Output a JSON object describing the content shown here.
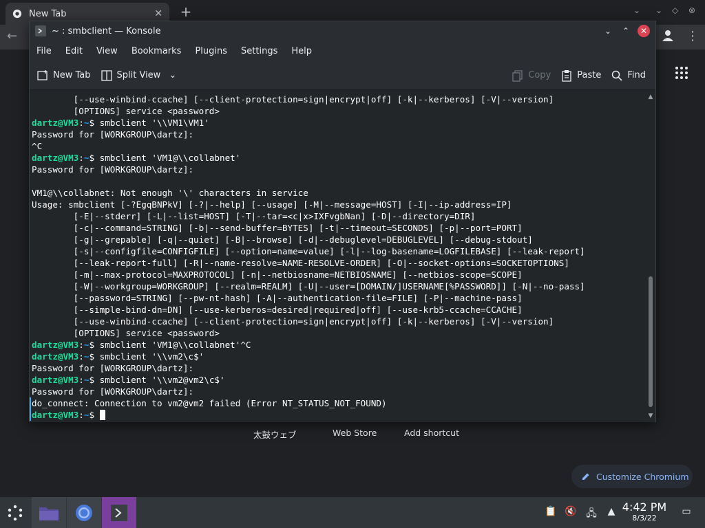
{
  "browser": {
    "tab_title": "New Tab",
    "tab_close": "✕",
    "new_tab": "+",
    "shortcuts": [
      "太鼓ウェブ",
      "Web Store",
      "Add shortcut"
    ],
    "customize_label": "Customize Chromium",
    "window_controls": [
      "⌄",
      "⌄",
      "◇",
      "⊗"
    ]
  },
  "konsole": {
    "title": "~ : smbclient — Konsole",
    "menu": [
      "File",
      "Edit",
      "View",
      "Bookmarks",
      "Plugins",
      "Settings",
      "Help"
    ],
    "toolbar": {
      "new_tab": "New Tab",
      "split_view": "Split View",
      "copy": "Copy",
      "paste": "Paste",
      "find": "Find"
    },
    "terminal": {
      "prompt_user": "dartz@VM3",
      "prompt_sep": ":",
      "prompt_path": "~",
      "prompt_end": "$ ",
      "lines": [
        {
          "type": "out",
          "text": "        [--use-winbind-ccache] [--client-protection=sign|encrypt|off] [-k|--kerberos] [-V|--version]"
        },
        {
          "type": "out",
          "text": "        [OPTIONS] service <password>"
        },
        {
          "type": "cmd",
          "text": "smbclient '\\\\VM1\\VM1'"
        },
        {
          "type": "out",
          "text": "Password for [WORKGROUP\\dartz]:"
        },
        {
          "type": "out",
          "text": "^C"
        },
        {
          "type": "cmd",
          "text": "smbclient 'VM1@\\\\collabnet'"
        },
        {
          "type": "out",
          "text": "Password for [WORKGROUP\\dartz]:"
        },
        {
          "type": "out",
          "text": ""
        },
        {
          "type": "out",
          "text": "VM1@\\\\collabnet: Not enough '\\' characters in service"
        },
        {
          "type": "out",
          "text": "Usage: smbclient [-?EgqBNPkV] [-?|--help] [--usage] [-M|--message=HOST] [-I|--ip-address=IP]"
        },
        {
          "type": "out",
          "text": "        [-E|--stderr] [-L|--list=HOST] [-T|--tar=<c|x>IXFvgbNan] [-D|--directory=DIR]"
        },
        {
          "type": "out",
          "text": "        [-c|--command=STRING] [-b|--send-buffer=BYTES] [-t|--timeout=SECONDS] [-p|--port=PORT]"
        },
        {
          "type": "out",
          "text": "        [-g|--grepable] [-q|--quiet] [-B|--browse] [-d|--debuglevel=DEBUGLEVEL] [--debug-stdout]"
        },
        {
          "type": "out",
          "text": "        [-s|--configfile=CONFIGFILE] [--option=name=value] [-l|--log-basename=LOGFILEBASE] [--leak-report]"
        },
        {
          "type": "out",
          "text": "        [--leak-report-full] [-R|--name-resolve=NAME-RESOLVE-ORDER] [-O|--socket-options=SOCKETOPTIONS]"
        },
        {
          "type": "out",
          "text": "        [-m|--max-protocol=MAXPROTOCOL] [-n|--netbiosname=NETBIOSNAME] [--netbios-scope=SCOPE]"
        },
        {
          "type": "out",
          "text": "        [-W|--workgroup=WORKGROUP] [--realm=REALM] [-U|--user=[DOMAIN/]USERNAME[%PASSWORD]] [-N|--no-pass]"
        },
        {
          "type": "out",
          "text": "        [--password=STRING] [--pw-nt-hash] [-A|--authentication-file=FILE] [-P|--machine-pass]"
        },
        {
          "type": "out",
          "text": "        [--simple-bind-dn=DN] [--use-kerberos=desired|required|off] [--use-krb5-ccache=CCACHE]"
        },
        {
          "type": "out",
          "text": "        [--use-winbind-ccache] [--client-protection=sign|encrypt|off] [-k|--kerberos] [-V|--version]"
        },
        {
          "type": "out",
          "text": "        [OPTIONS] service <password>"
        },
        {
          "type": "cmd",
          "text": "smbclient 'VM1@\\\\collabnet'^C"
        },
        {
          "type": "cmd",
          "text": "smbclient '\\\\vm2\\c$'"
        },
        {
          "type": "out",
          "text": "Password for [WORKGROUP\\dartz]:"
        },
        {
          "type": "cmd",
          "text": "smbclient '\\\\vm2@vm2\\c$'"
        },
        {
          "type": "out",
          "text": "Password for [WORKGROUP\\dartz]:"
        },
        {
          "type": "out",
          "text": "do_connect: Connection to vm2@vm2 failed (Error NT_STATUS_NOT_FOUND)",
          "marked": true
        },
        {
          "type": "cmd",
          "text": "",
          "cursor": true,
          "marked": true
        }
      ]
    }
  },
  "taskbar": {
    "time": "4:42 PM",
    "date": "8/3/22",
    "accent_active": "#7a3f9d"
  },
  "colors": {
    "prompt_user": "#1cdc9a",
    "prompt_path": "#1d99f3",
    "close_button": "#da4453",
    "customize_text": "#8ab4f8"
  }
}
